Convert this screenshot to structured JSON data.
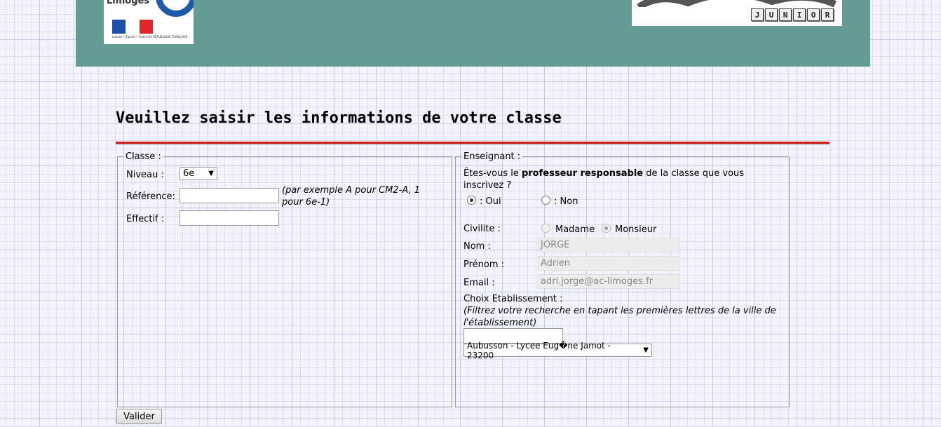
{
  "header": {
    "logo_left_text": "Limoges",
    "logo_left_caption": "Liberté • Égalité • Fraternité RÉPUBLIQUE FRANÇAISE",
    "logo_right_text": "JUNIOR",
    "logo_right_letters": [
      "J",
      "U",
      "N",
      "I",
      "O",
      "R"
    ]
  },
  "page": {
    "title": "Veuillez saisir les informations de votre classe"
  },
  "classe": {
    "legend": "Classe :",
    "niveau_label": "Niveau :",
    "niveau_value": "6e",
    "reference_label": "Référence:",
    "reference_value": "",
    "reference_hint": "(par exemple A pour CM2-A, 1 pour 6e-1)",
    "effectif_label": "Effectif :",
    "effectif_value": ""
  },
  "enseignant": {
    "legend": "Enseignant :",
    "question_part1": "Êtes-vous le ",
    "question_bold": "professeur responsable",
    "question_part2": " de la classe que vous inscrivez ?",
    "oui_label": ": Oui",
    "non_label": ": Non",
    "oui_selected": true,
    "civilite_label": "Civilite :",
    "madame_label": "Madame",
    "monsieur_label": "Monsieur",
    "monsieur_selected": true,
    "nom_label": "Nom :",
    "nom_value": "JORGE",
    "prenom_label": "Prénom :",
    "prenom_value": "Adrien",
    "email_label": "Email :",
    "email_value": "adri.jorge@ac-limoges.fr",
    "etab_label": "Choix Etablissement :",
    "etab_hint": "(Filtrez votre recherche en tapant les premières lettres de la ville de l'établissement)",
    "etab_filter_value": "",
    "etab_selected": "Aubusson - Lycee Eug�ne Jamot - 23200"
  },
  "actions": {
    "submit_label": "Valider"
  },
  "colors": {
    "header_bg": "#649b94",
    "title_rule": "#d41d1d"
  }
}
